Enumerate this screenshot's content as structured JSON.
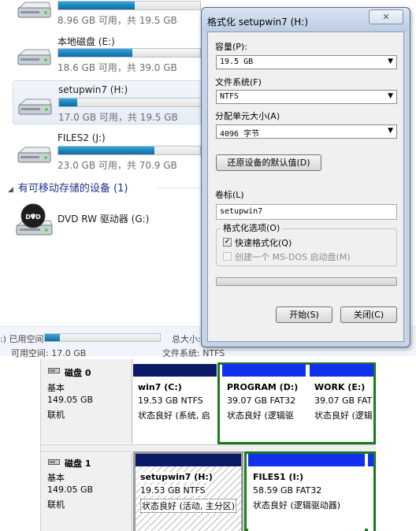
{
  "explorer": {
    "drives": [
      {
        "name": "",
        "info": "8.96 GB 可用，共 19.5 GB",
        "used_fraction": 0.54,
        "selected": false
      },
      {
        "name": "本地磁盘 (E:)",
        "info": "18.6 GB 可用，共 39.0 GB",
        "used_fraction": 0.52,
        "selected": false
      },
      {
        "name": "setupwin7 (H:)",
        "info": "17.0 GB 可用，共 19.5 GB",
        "used_fraction": 0.13,
        "selected": true
      },
      {
        "name": "FILES2 (J:)",
        "info": "23.0 GB 可用，共 70.9 GB",
        "used_fraction": 0.68,
        "selected": false
      }
    ],
    "removable_section": "有可移动存储的设备 (1)",
    "dvd": {
      "label": "DVD",
      "name": "DVD RW 驱动器 (G:)"
    },
    "statusbar": {
      "used_label": ":) 已用空间:",
      "used_fraction": 0.13,
      "total_label": "总大小:",
      "free_label": "可用空间: 17.0 GB",
      "fs_label": "文件系统: NTFS"
    }
  },
  "dialog": {
    "title": "格式化 setupwin7 (H:)",
    "close_glyph": "✕",
    "capacity_label": "容量(P):",
    "capacity_value": "19.5 GB",
    "filesystem_label": "文件系统(F)",
    "filesystem_value": "NTFS",
    "alloc_label": "分配单元大小(A)",
    "alloc_value": "4096 字节",
    "restore_button": "还原设备的默认值(D)",
    "volume_label_label": "卷标(L)",
    "volume_label_value": "setupwin7",
    "options_label": "格式化选项(O)",
    "quick_format_label": "快速格式化(Q)",
    "quick_format_checked": true,
    "msdos_label": "创建一个 MS-DOS 启动盘(M)",
    "msdos_checked": false,
    "progress": 0,
    "start_button": "开始(S)",
    "close_button": "关闭(C)"
  },
  "disk_management": {
    "disks": [
      {
        "name": "磁盘 0",
        "type": "基本",
        "size": "149.05 GB",
        "status": "联机",
        "partitions": [
          {
            "name": "win7  (C:)",
            "size": "19.53 GB NTFS",
            "status": "状态良好 (系统, 启"
          },
          {
            "name": "PROGRAM  (D:)",
            "size": "39.07 GB FAT32",
            "status": "状态良好 (逻辑驱"
          },
          {
            "name": "WORK  (E:)",
            "size": "39.07 GB FAT",
            "status": "状态良好 (逻辑"
          }
        ]
      },
      {
        "name": "磁盘 1",
        "type": "基本",
        "size": "149.05 GB",
        "status": "联机",
        "partitions": [
          {
            "name": "setupwin7  (H:)",
            "size": "19.53 GB NTFS",
            "status": "状态良好 (活动, 主分区)"
          },
          {
            "name": "FILES1  (I:)",
            "size": "58.59 GB FAT32",
            "status": "状态良好 (逻辑驱动器)"
          },
          {
            "name": "",
            "size": "",
            "status": ""
          }
        ]
      }
    ]
  },
  "colors": {
    "primary_header": "#0a1a66",
    "logical_header": "#1131ee",
    "extended_frame": "#1e7a1e",
    "usage_bar": "#1c86bf"
  }
}
